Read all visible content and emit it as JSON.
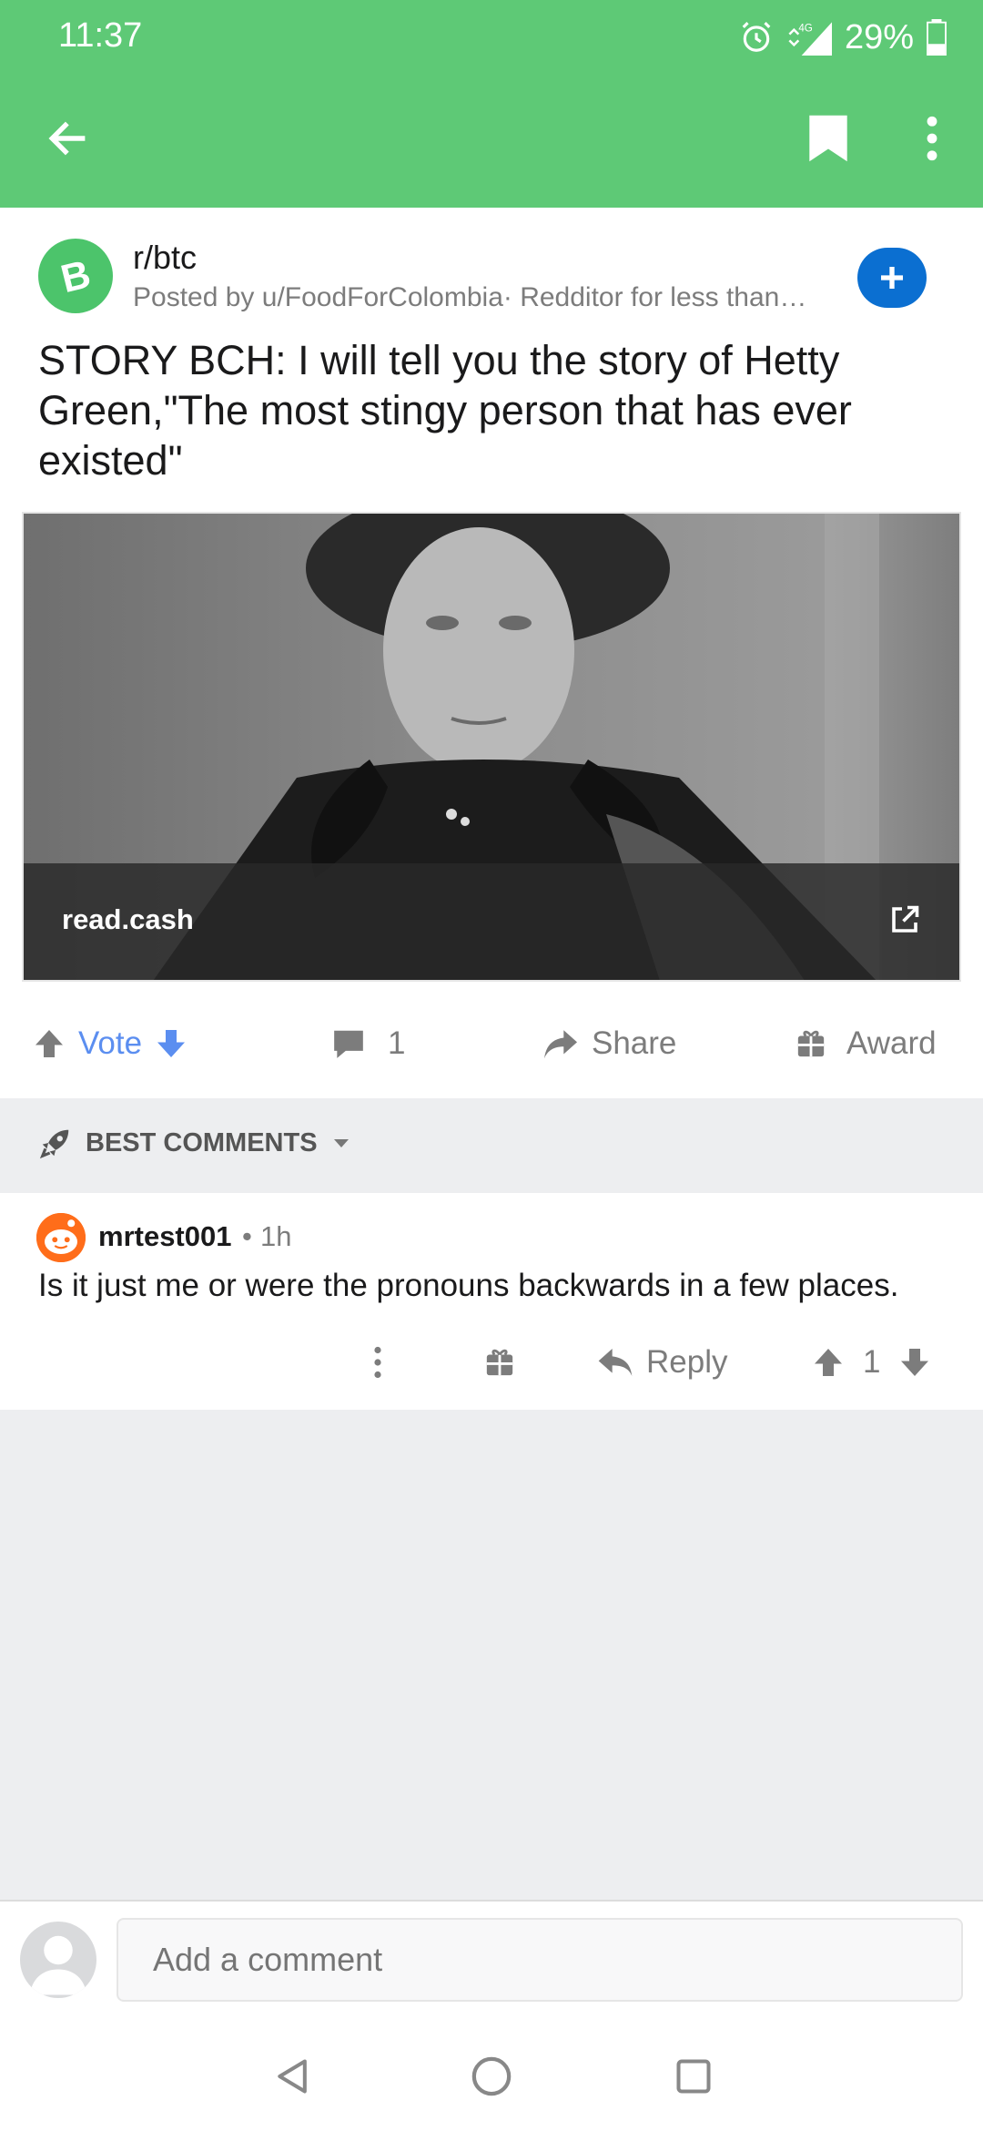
{
  "status_bar": {
    "time": "11:37",
    "network": "4G",
    "battery": "29%"
  },
  "app_bar": {
    "back_icon": "arrow-left-icon",
    "bookmark_icon": "bookmark-icon",
    "more_icon": "more-vertical-icon"
  },
  "post": {
    "subreddit": "r/btc",
    "posted_by": "Posted by u/FoodForColombia· Redditor for less than…",
    "title": "STORY BCH: I will tell you the story of Hetty Green,\"The most stingy person that has ever existed\"",
    "link_domain": "read.cash",
    "join_icon": "plus-icon"
  },
  "actions": {
    "vote": "Vote",
    "comments_count": "1",
    "share": "Share",
    "award": "Award"
  },
  "sort": {
    "label": "BEST COMMENTS"
  },
  "comment": {
    "author": "mrtest001",
    "separator": "•",
    "time": "1h",
    "body": "Is it just me or were the pronouns backwards in a few places.",
    "reply": "Reply",
    "score": "1"
  },
  "composer": {
    "placeholder": "Add a comment"
  },
  "colors": {
    "app_green": "#5ec976",
    "vote_blue": "#5b8ef0",
    "join_blue": "#0b6fd1",
    "avatar_orange": "#ff6d1a"
  }
}
